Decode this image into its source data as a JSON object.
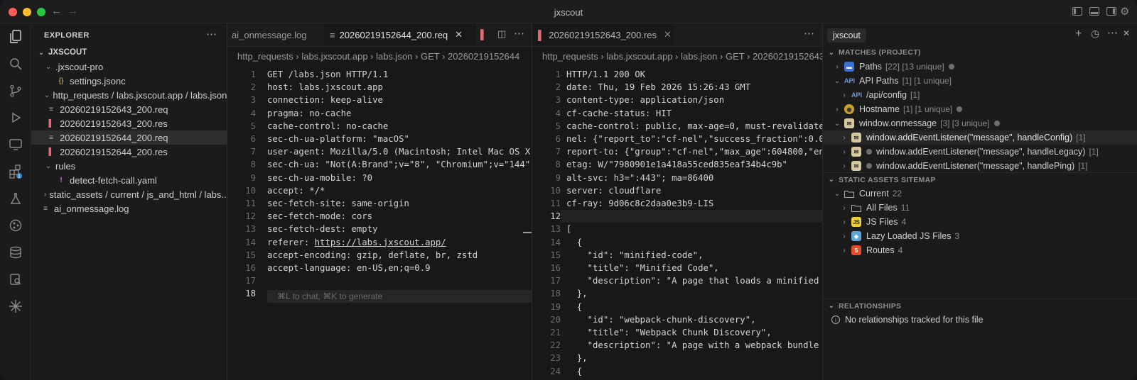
{
  "window": {
    "title": "jxscout"
  },
  "explorer": {
    "header": "EXPLORER",
    "items": [
      {
        "label": "JXSCOUT"
      },
      {
        "label": ".jxscout-pro"
      },
      {
        "label": "settings.jsonc"
      },
      {
        "label": "http_requests / labs.jxscout.app / labs.json..."
      },
      {
        "label": "20260219152643_200.req"
      },
      {
        "label": "20260219152643_200.res"
      },
      {
        "label": "20260219152644_200.req"
      },
      {
        "label": "20260219152644_200.res"
      },
      {
        "label": "rules"
      },
      {
        "label": "detect-fetch-call.yaml"
      },
      {
        "label": "static_assets / current / js_and_html / labs...."
      },
      {
        "label": "ai_onmessage.log"
      }
    ]
  },
  "left_editor": {
    "tabs": [
      {
        "label": "ai_onmessage.log"
      },
      {
        "label": "20260219152644_200.req"
      }
    ],
    "breadcrumb": "http_requests  ›  labs.jxscout.app  ›  labs.json  ›  GET  ›  20260219152644",
    "lines": [
      "GET /labs.json HTTP/1.1",
      "host: labs.jxscout.app",
      "connection: keep-alive",
      "pragma: no-cache",
      "cache-control: no-cache",
      "sec-ch-ua-platform: \"macOS\"",
      "user-agent: Mozilla/5.0 (Macintosh; Intel Mac OS X",
      "sec-ch-ua: \"Not(A:Brand\";v=\"8\", \"Chromium\";v=\"144\"",
      "sec-ch-ua-mobile: ?0",
      "accept: */*",
      "sec-fetch-site: same-origin",
      "sec-fetch-mode: cors",
      "sec-fetch-dest: empty",
      "referer: https://labs.jxscout.app/",
      "accept-encoding: gzip, deflate, br, zstd",
      "accept-language: en-US,en;q=0.9",
      "",
      ""
    ],
    "line_numbers": [
      "1",
      "2",
      "3",
      "4",
      "5",
      "6",
      "7",
      "8",
      "9",
      "10",
      "11",
      "12",
      "13",
      "14",
      "15",
      "16",
      "17",
      "18"
    ],
    "prompt_placeholder": "⌘L to chat, ⌘K to generate"
  },
  "right_editor": {
    "tabs": [
      {
        "label": "20260219152643_200.res"
      }
    ],
    "breadcrumb": "http_requests  ›  labs.jxscout.app  ›  labs.json  ›  GET  ›  20260219152643",
    "lines": [
      "HTTP/1.1 200 OK",
      "date: Thu, 19 Feb 2026 15:26:43 GMT",
      "content-type: application/json",
      "cf-cache-status: HIT",
      "cache-control: public, max-age=0, must-revalidate",
      "nel: {\"report_to\":\"cf-nel\",\"success_fraction\":0.0,\"",
      "report-to: {\"group\":\"cf-nel\",\"max_age\":604800,\"endp",
      "etag: W/\"7980901e1a418a55ced835eaf34b4c9b\"",
      "alt-svc: h3=\":443\"; ma=86400",
      "server: cloudflare",
      "cf-ray: 9d06c8c2daa0e3b9-LIS",
      "",
      "[",
      "  {",
      "    \"id\": \"minified-code\",",
      "    \"title\": \"Minified Code\",",
      "    \"description\": \"A page that loads a minified JS",
      "  },",
      "  {",
      "    \"id\": \"webpack-chunk-discovery\",",
      "    \"title\": \"Webpack Chunk Discovery\",",
      "    \"description\": \"A page with a webpack bundle ar",
      "  },",
      "  {"
    ],
    "line_numbers": [
      "1",
      "2",
      "3",
      "4",
      "5",
      "6",
      "7",
      "8",
      "9",
      "10",
      "11",
      "12",
      "13",
      "14",
      "15",
      "16",
      "17",
      "18",
      "19",
      "20",
      "21",
      "22",
      "23",
      "24"
    ]
  },
  "sidebar": {
    "title": "jxscout",
    "matches_header": "MATCHES (PROJECT)",
    "matches": [
      {
        "label": "Paths",
        "count": "[22] [13 unique]"
      },
      {
        "label": "API Paths",
        "count": "[1] [1 unique]"
      },
      {
        "label": "/api/config",
        "count": "[1]"
      },
      {
        "label": "Hostname",
        "count": "[1] [1 unique]"
      },
      {
        "label": "window.onmessage",
        "count": "[3] [3 unique]"
      },
      {
        "label": "window.addEventListener(\"message\", handleConfig)",
        "count": "[1]"
      },
      {
        "label": "window.addEventListener(\"message\", handleLegacy)",
        "count": "[1]"
      },
      {
        "label": "window.addEventListener(\"message\", handlePing)",
        "count": "[1]"
      }
    ],
    "sitemap_header": "STATIC ASSETS SITEMAP",
    "sitemap": [
      {
        "label": "Current",
        "count": "22"
      },
      {
        "label": "All Files",
        "count": "11"
      },
      {
        "label": "JS Files",
        "count": "4"
      },
      {
        "label": "Lazy Loaded JS Files",
        "count": "3"
      },
      {
        "label": "Routes",
        "count": "4"
      }
    ],
    "relationships_header": "RELATIONSHIPS",
    "relationships_text": "No relationships tracked for this file"
  }
}
